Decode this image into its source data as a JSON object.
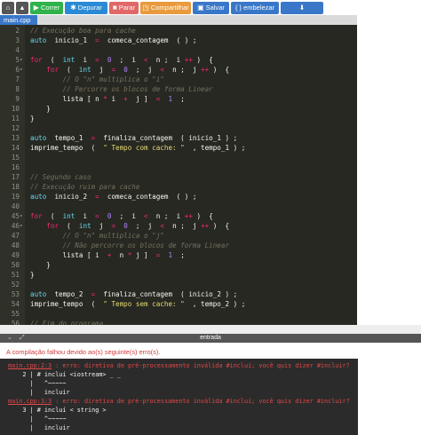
{
  "toolbar": {
    "run_label": "Correr",
    "debug_label": "Depurar",
    "stop_label": "Parar",
    "share_label": "Compartilhar",
    "save_label": "Salvar",
    "beautify_label": "{ } embelezar"
  },
  "tabs": [
    {
      "label": "main.cpp"
    }
  ],
  "editor": {
    "lines": [
      {
        "n": "2",
        "fold": "",
        "html": "<span class=\"c\">// Execução boa para cache</span>"
      },
      {
        "n": "3",
        "fold": "",
        "html": "<span class=\"k\">auto</span>  inicio_1  <span class=\"kw\">=</span>  comeca_contagem  ( ) ;"
      },
      {
        "n": "4",
        "fold": "",
        "html": ""
      },
      {
        "n": "5",
        "fold": "▾",
        "html": "<span class=\"kw\">for</span>  (  <span class=\"k\">int</span>  i  <span class=\"kw\">=</span>  <span class=\"n\">0</span>  ;  i  <span class=\"kw\">&lt;</span>  n ;  i <span class=\"kw\">++</span> )  {"
      },
      {
        "n": "6",
        "fold": "▾",
        "html": "    <span class=\"kw\">for</span>  (  <span class=\"k\">int</span>  j  <span class=\"kw\">=</span>  <span class=\"n\">0</span>  ;  j  <span class=\"kw\">&lt;</span>  n ;  j <span class=\"kw\">++</span> )  {"
      },
      {
        "n": "7",
        "fold": "",
        "html": "        <span class=\"c\">// O \"n\" multiplica o \"i\"</span>"
      },
      {
        "n": "8",
        "fold": "",
        "html": "        <span class=\"c\">// Percorre os blocos de forma Linear</span>"
      },
      {
        "n": "9",
        "fold": "",
        "html": "        lista [ n <span class=\"kw\">*</span> i  <span class=\"kw\">+</span>  j ]  <span class=\"kw\">=</span>  <span class=\"n\">1</span>  ;"
      },
      {
        "n": "10",
        "fold": "",
        "html": "    }"
      },
      {
        "n": "11",
        "fold": "",
        "html": "}"
      },
      {
        "n": "12",
        "fold": "",
        "html": ""
      },
      {
        "n": "13",
        "fold": "",
        "html": "<span class=\"k\">auto</span>  tempo_1  <span class=\"kw\">=</span>  finaliza_contagem  ( inicio_1 ) ;"
      },
      {
        "n": "14",
        "fold": "",
        "html": "imprime_tempo  (  <span class=\"s\">\" Tempo com cache: \"</span>  , tempo_1 ) ;"
      },
      {
        "n": "15",
        "fold": "",
        "html": ""
      },
      {
        "n": "16",
        "fold": "",
        "html": ""
      },
      {
        "n": "17",
        "fold": "",
        "html": "<span class=\"c\">// Segundo caso</span>"
      },
      {
        "n": "18",
        "fold": "",
        "html": "<span class=\"c\">// Execução ruim para cache</span>"
      },
      {
        "n": "19",
        "fold": "",
        "html": "<span class=\"k\">auto</span>  inicio_2  <span class=\"kw\">=</span>  comeca_contagem  ( ) ;"
      },
      {
        "n": "40",
        "fold": "",
        "html": ""
      },
      {
        "n": "45",
        "fold": "▾",
        "html": "<span class=\"kw\">for</span>  (  <span class=\"k\">int</span>  i  <span class=\"kw\">=</span>  <span class=\"n\">0</span>  ;  i  <span class=\"kw\">&lt;</span>  n ;  i <span class=\"kw\">++</span> )  {"
      },
      {
        "n": "46",
        "fold": "▾",
        "html": "    <span class=\"kw\">for</span>  (  <span class=\"k\">int</span>  j  <span class=\"kw\">=</span>  <span class=\"n\">0</span>  ;  j  <span class=\"kw\">&lt;</span>  n ;  j <span class=\"kw\">++</span> )  {"
      },
      {
        "n": "47",
        "fold": "",
        "html": "        <span class=\"c\">// O \"n\" multiplica o \"j\"</span>"
      },
      {
        "n": "48",
        "fold": "",
        "html": "        <span class=\"c\">// Não percorre os blocos de forma Linear</span>"
      },
      {
        "n": "49",
        "fold": "",
        "html": "        lista [ i  <span class=\"kw\">+</span>  n <span class=\"kw\">*</span> j ]  <span class=\"kw\">=</span>  <span class=\"n\">1</span>  ;"
      },
      {
        "n": "50",
        "fold": "",
        "html": "    }"
      },
      {
        "n": "51",
        "fold": "",
        "html": "}"
      },
      {
        "n": "52",
        "fold": "",
        "html": ""
      },
      {
        "n": "53",
        "fold": "",
        "html": "<span class=\"k\">auto</span>  tempo_2  <span class=\"kw\">=</span>  finaliza_contagem  ( inicio_2 ) ;"
      },
      {
        "n": "54",
        "fold": "",
        "html": "imprime_tempo  (  <span class=\"s\">\" Tempo sem cache: \"</span>  , tempo_2 ) ;"
      },
      {
        "n": "55",
        "fold": "",
        "html": ""
      },
      {
        "n": "56",
        "fold": "",
        "html": "<span class=\"c\">// Fim do programa</span>"
      },
      {
        "n": "57",
        "fold": "",
        "html": "<span class=\"kw\">retorna</span>  <span class=\"n\">0</span>  ;"
      },
      {
        "n": "58",
        "fold": "",
        "html": "}"
      },
      {
        "n": "59",
        "fold": "",
        "html": ""
      }
    ]
  },
  "output": {
    "label": "entrada",
    "error_title": "A compilação falhou devido ao(s) seguinte(s) erro(s).",
    "lines": [
      {
        "html": "<span class=\"link\">main.cpp:2:3</span> <span class=\"red\">: erro: diretiva de pré-processamento inválida #incluí; você quis dizer #incluir?</span>"
      },
      {
        "html": "    2 | # incluí &lt;iostream&gt; _ _"
      },
      {
        "html": "      |   ^~~~~~"
      },
      {
        "html": "      |   incluir"
      },
      {
        "html": "<span class=\"link\">main.cpp:3:3</span> <span class=\"red\">: erro: diretiva de pré-processamento inválida #incluí; você quis dizer #incluir?</span>"
      },
      {
        "html": "    3 | # incluí &lt; string &gt;"
      },
      {
        "html": "      |   ^~~~~~"
      },
      {
        "html": "      |   incluir"
      }
    ]
  }
}
